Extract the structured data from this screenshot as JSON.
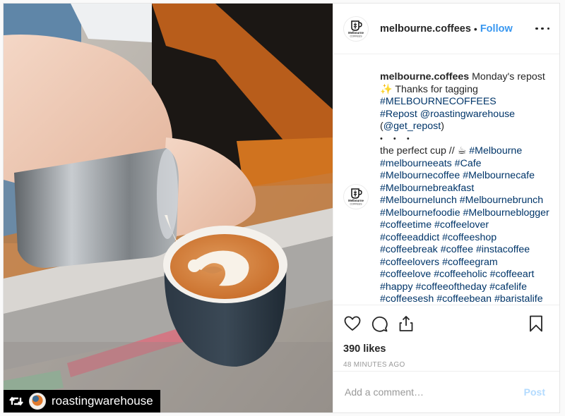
{
  "photo": {
    "alt": "Barista pouring latte art into a dark cup",
    "repost_badge": {
      "icon": "repost-icon",
      "username": "roastingwarehouse"
    }
  },
  "header": {
    "avatar_label": "Melbourne COFFEES",
    "username": "melbourne.coffees",
    "separator": "•",
    "follow_label": "Follow",
    "more_icon": "more-options-icon"
  },
  "caption": {
    "username": "melbourne.coffees",
    "lines": [
      {
        "text": "Monday's repost",
        "type": "text"
      },
      {
        "text": "✨ Thanks for tagging",
        "type": "text"
      },
      {
        "text": "#MELBOURNECOFFEES",
        "type": "tag"
      },
      {
        "text": "#Repost @roastingwarehouse",
        "type": "tag"
      },
      {
        "text": "(@get_repost)",
        "type": "text"
      },
      {
        "text": "• • •",
        "type": "dots"
      },
      {
        "text": "the perfect cup // ☕ ",
        "type": "text"
      },
      {
        "text": "#Melbourne",
        "type": "tag"
      },
      {
        "text": "#melbourneeats #Cafe",
        "type": "tag"
      },
      {
        "text": "#Melbournecoffee #Melbournecafe",
        "type": "tag"
      },
      {
        "text": "#Melbournebreakfast",
        "type": "tag"
      },
      {
        "text": "#Melbournelunch #Melbournebrunch",
        "type": "tag"
      },
      {
        "text": "#Melbournefoodie #Melbourneblogger",
        "type": "tag"
      },
      {
        "text": "#coffeetime #coffeelover",
        "type": "tag"
      },
      {
        "text": "#coffeeaddict #coffeeshop",
        "type": "tag"
      },
      {
        "text": "#coffeebreak #coffee #instacoffee",
        "type": "tag"
      },
      {
        "text": "#coffeelovers #coffeegram",
        "type": "tag"
      },
      {
        "text": "#coffeelove #coffeeholic #coffeeart",
        "type": "tag"
      },
      {
        "text": "#happy #coffeeoftheday #cafelife",
        "type": "tag"
      },
      {
        "text": "#coffeesesh #coffeebean #baristalife",
        "type": "tag"
      }
    ]
  },
  "actions": {
    "icons": [
      "heart-icon",
      "comment-icon",
      "share-icon",
      "bookmark-icon"
    ],
    "likes": "390 likes",
    "timestamp": "48 MINUTES AGO"
  },
  "comment_box": {
    "placeholder": "Add a comment…",
    "value": "",
    "post_label": "Post"
  },
  "colors": {
    "link": "#3897f0",
    "hashtag": "#003569",
    "post_disabled": "#b3dbff",
    "muted": "#999999"
  }
}
